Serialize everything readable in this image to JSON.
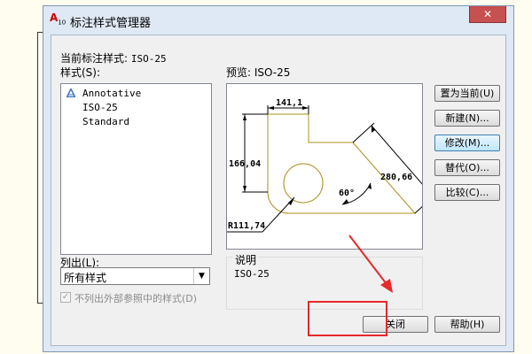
{
  "window": {
    "title": "标注样式管理器",
    "app_icon_text": "A",
    "app_icon_sub": "10",
    "close_symbol": "✕"
  },
  "current_style": {
    "label": "当前标注样式:",
    "value": "ISO-25"
  },
  "styles_list": {
    "label": "样式(S):",
    "items": [
      "Annotative",
      "ISO-25",
      "Standard"
    ]
  },
  "preview": {
    "label": "预览: ISO-25",
    "dims": {
      "top": "141,1",
      "left": "166,04",
      "right": "280,66",
      "angle": "60°",
      "radius": "R111,74"
    },
    "line_color": "#a8901e"
  },
  "buttons": {
    "set_current": "置为当前(U)",
    "new": "新建(N)...",
    "modify": "修改(M)...",
    "override": "替代(O)...",
    "compare": "比较(C)...",
    "close": "关闭",
    "help": "帮助(H)"
  },
  "list_filter": {
    "label": "列出(L):",
    "selected": "所有样式",
    "arrow": "▼"
  },
  "exclude_xref": {
    "checked": true,
    "label": "不列出外部参照中的样式(D)"
  },
  "description": {
    "label": "说明",
    "value": "ISO-25"
  },
  "colors": {
    "dialog_frame": "#dfe9f5",
    "close_button": "#c75050",
    "highlight": "#e8282a"
  }
}
